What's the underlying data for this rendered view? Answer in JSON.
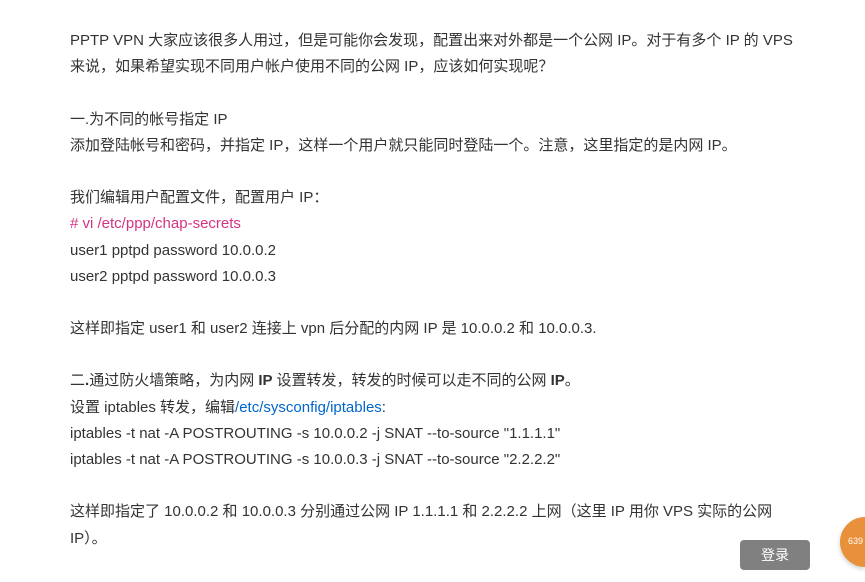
{
  "para1": "PPTP VPN 大家应该很多人用过，但是可能你会发现，配置出来对外都是一个公网 IP。对于有多个 IP 的 VPS 来说，如果希望实现不同用户帐户使用不同的公网 IP，应该如何实现呢？",
  "section1_title": "一.为不同的帐号指定 IP",
  "section1_desc": "添加登陆帐号和密码，并指定  IP，这样一个用户就只能同时登陆一个。注意，这里指定的是内网 IP。",
  "edit_text": "我们编辑用户配置文件，配置用户 IP：",
  "vi_cmd": "# vi /etc/ppp/chap-secrets",
  "user1_line": "user1 pptpd password 10.0.0.2",
  "user2_line": "user2 pptpd password 10.0.0.3",
  "result1": "这样即指定 user1 和 user2 连接上 vpn 后分配的内网 IP 是 10.0.0.2 和 10.0.0.3.",
  "section2_prefix": "二",
  "section2_mid": ".",
  "section2_text1": "通过防火墙策略，为内网 ",
  "section2_ip": "IP ",
  "section2_text2": "设置转发，转发的时候可以走不同的公网 ",
  "section2_ip2": "IP",
  "section2_end": "。",
  "iptables_edit_prefix": "设置 iptables 转发，编辑",
  "iptables_path": "/etc/sysconfig/iptables",
  "iptables_colon": ":",
  "iptables1": "iptables -t nat -A POSTROUTING -s 10.0.0.2 -j SNAT --to-source \"1.1.1.1\"",
  "iptables2": "iptables -t nat -A POSTROUTING -s 10.0.0.3 -j SNAT --to-source \"2.2.2.2\"",
  "result2": "这样即指定了 10.0.0.2 和 10.0.0.3 分别通过公网 IP 1.1.1.1 和 2.2.2.2 上网（这里 IP 用你 VPS 实际的公网 IP）。",
  "login_label": "登录",
  "badge_text": "639"
}
